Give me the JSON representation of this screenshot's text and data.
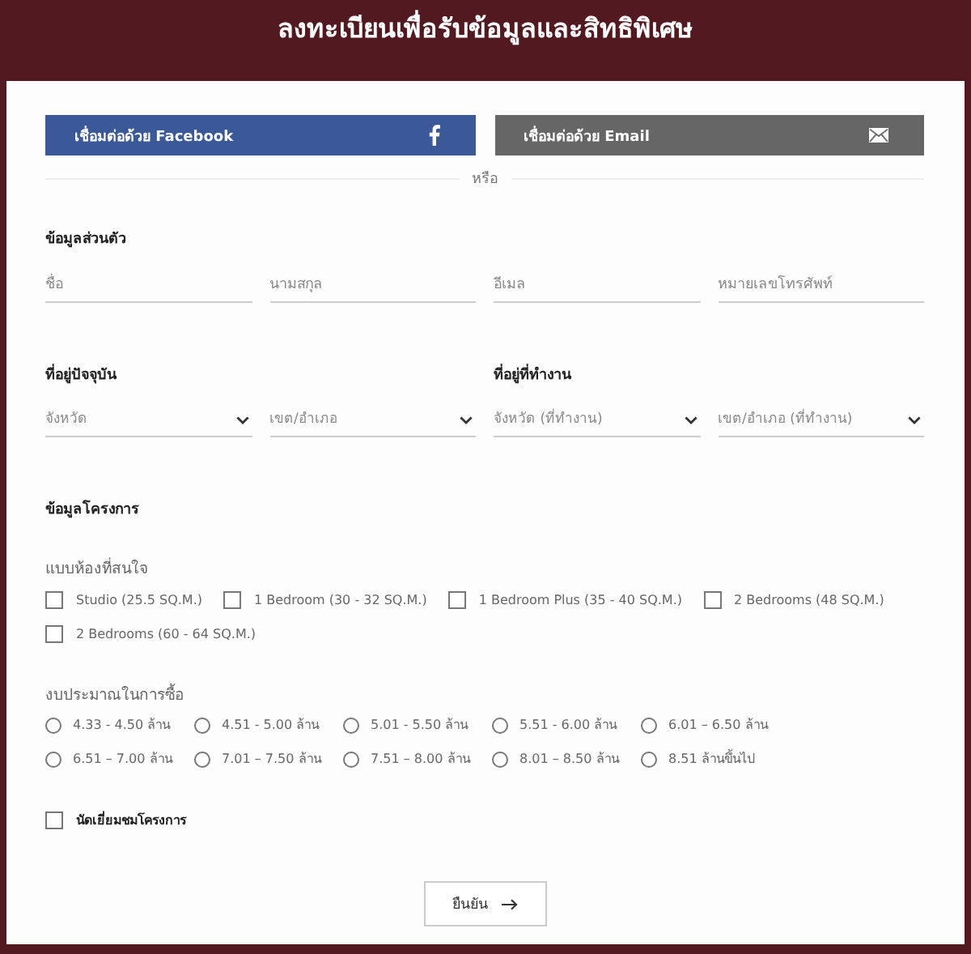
{
  "title": "ลงทะเบียนเพื่อรับข้อมูลและสิทธิพิเศษ",
  "social_buttons": [
    {
      "kind": "facebook",
      "label": "เชื่อมต่อด้วย Facebook"
    },
    {
      "kind": "email",
      "label": "เชื่อมต่อด้วย Email"
    }
  ],
  "divider_text": "หรือ",
  "personal": {
    "heading": "ข้อมูลส่วนตัว",
    "fields": [
      {
        "placeholder": "ชื่อ"
      },
      {
        "placeholder": "นามสกุล"
      },
      {
        "placeholder": "อีเมล"
      },
      {
        "placeholder": "หมายเลขโทรศัพท์"
      }
    ]
  },
  "addresses": [
    {
      "heading": "ที่อยู่ปัจจุบัน",
      "selects": [
        {
          "placeholder": "จังหวัด"
        },
        {
          "placeholder": "เขต/อำเภอ"
        }
      ]
    },
    {
      "heading": "ที่อยู่ที่ทำงาน",
      "selects": [
        {
          "placeholder": "จังหวัด (ที่ทำงาน)"
        },
        {
          "placeholder": "เขต/อำเภอ (ที่ทำงาน)"
        }
      ]
    }
  ],
  "project": {
    "heading": "ข้อมูลโครงการ",
    "room_types": {
      "label": "แบบห้องที่สนใจ",
      "options": [
        {
          "label": "Studio (25.5 SQ.M.)",
          "checked": false
        },
        {
          "label": "1 Bedroom (30 - 32 SQ.M.)",
          "checked": false
        },
        {
          "label": "1 Bedroom Plus (35 - 40 SQ.M.)",
          "checked": false
        },
        {
          "label": "2 Bedrooms (48 SQ.M.)",
          "checked": false
        },
        {
          "label": "2 Bedrooms (60 - 64 SQ.M.)",
          "checked": false
        }
      ]
    },
    "budget": {
      "label": "งบประมาณในการซื้อ",
      "options": [
        {
          "label": "4.33 - 4.50 ล้าน",
          "selected": false
        },
        {
          "label": "4.51 - 5.00 ล้าน",
          "selected": false
        },
        {
          "label": "5.01 - 5.50 ล้าน",
          "selected": false
        },
        {
          "label": "5.51 - 6.00 ล้าน",
          "selected": false
        },
        {
          "label": "6.01 – 6.50 ล้าน",
          "selected": false
        },
        {
          "label": "6.51 – 7.00 ล้าน",
          "selected": false
        },
        {
          "label": "7.01 – 7.50 ล้าน",
          "selected": false
        },
        {
          "label": "7.51 – 8.00 ล้าน",
          "selected": false
        },
        {
          "label": "8.01 – 8.50 ล้าน",
          "selected": false
        },
        {
          "label": "8.51 ล้านขึ้นไป",
          "selected": false
        }
      ]
    },
    "visit": {
      "label": "นัดเยี่ยมชมโครงการ",
      "checked": false
    }
  },
  "submit": {
    "label": "ยืนยัน"
  }
}
